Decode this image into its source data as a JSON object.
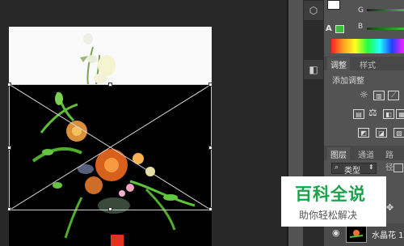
{
  "color_panel": {
    "g_label": "G",
    "b_label": "B",
    "a_label": "A"
  },
  "adjustments_panel": {
    "tabs": [
      "调整",
      "样式"
    ],
    "heading": "添加调整"
  },
  "layers_panel": {
    "tabs": [
      "图层",
      "通道",
      "路径"
    ],
    "filter_value": "类型",
    "layer_name": "水晶花 1"
  },
  "watermark": {
    "title": "百科全说",
    "subtitle": "助你轻松解决"
  },
  "colors": {
    "accent_green": "#1aa34a",
    "panel_bg": "#535353",
    "canvas_bg": "#282828"
  }
}
